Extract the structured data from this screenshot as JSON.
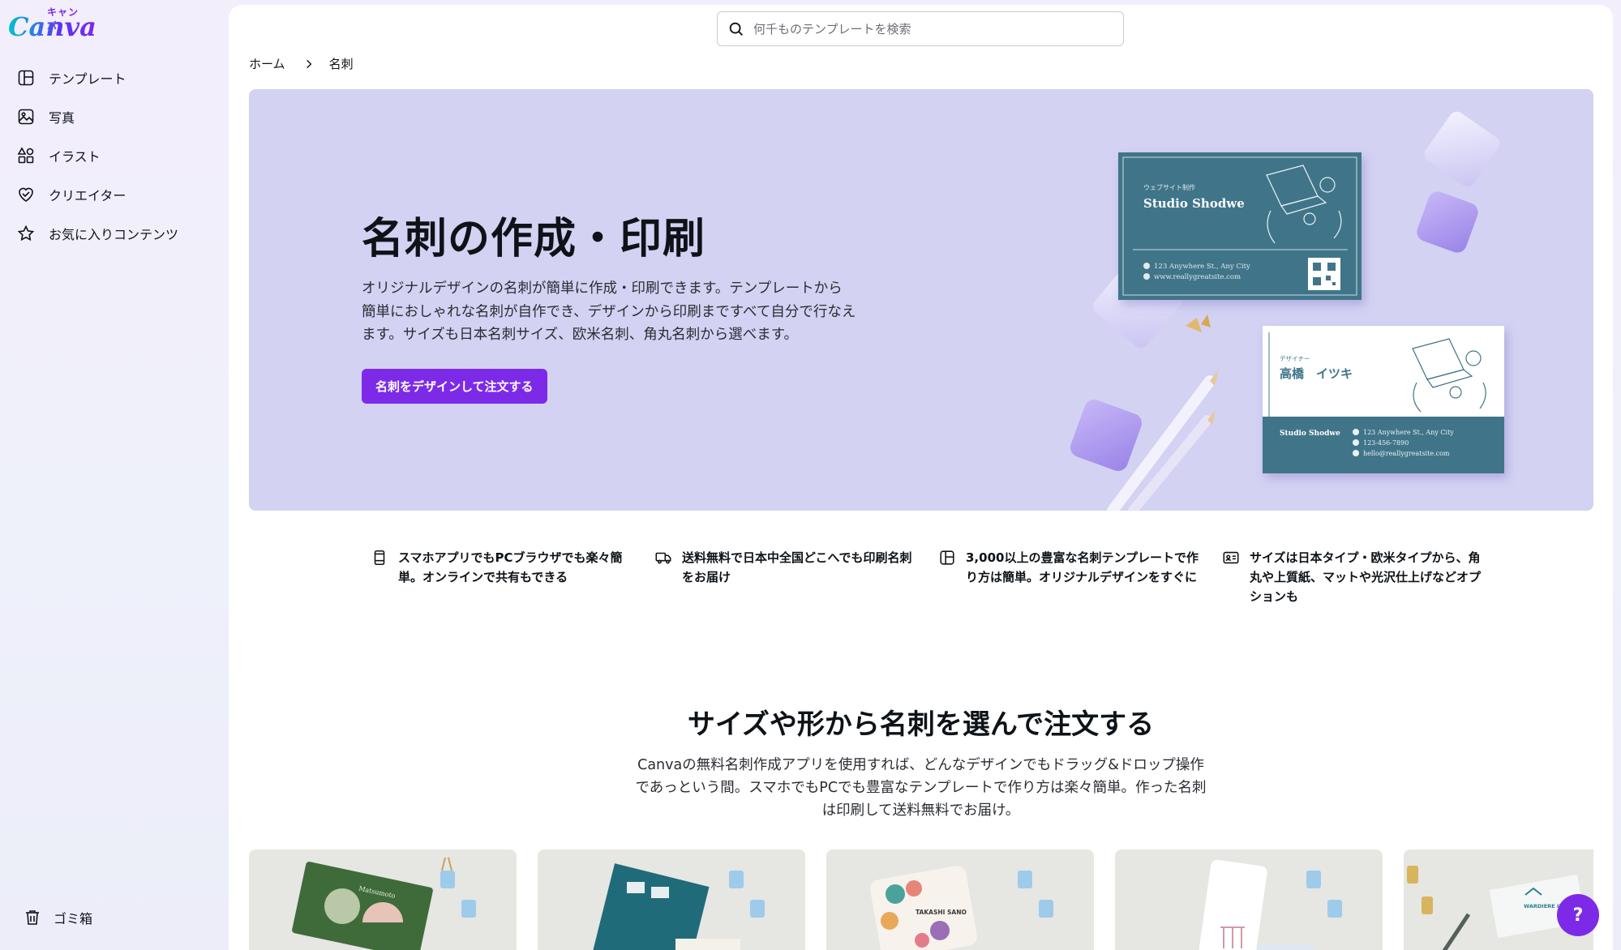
{
  "brand": {
    "logo_kana": "キャンバ",
    "logo_word": "Canva"
  },
  "sidebar": {
    "items": [
      {
        "label": "テンプレート",
        "icon": "template-icon"
      },
      {
        "label": "写真",
        "icon": "photo-icon"
      },
      {
        "label": "イラスト",
        "icon": "shapes-icon"
      },
      {
        "label": "クリエイター",
        "icon": "heart-icon"
      },
      {
        "label": "お気に入りコンテンツ",
        "icon": "star-icon"
      }
    ],
    "trash_label": "ゴミ箱"
  },
  "search": {
    "placeholder": "何千ものテンプレートを検索"
  },
  "breadcrumb": {
    "home": "ホーム",
    "current": "名刺"
  },
  "hero": {
    "title": "名刺の作成・印刷",
    "description": "オリジナルデザインの名刺が簡単に作成・印刷できます。テンプレートから簡単におしゃれな名刺が自作でき、デザインから印刷まですべて自分で行なえます。サイズも日本名刺サイズ、欧米名刺、角丸名刺から選べます。",
    "cta_label": "名刺をデザインして注文する",
    "card1": {
      "subtitle": "ウェブサイト制作",
      "name": "Studio Shodwe",
      "address": "123 Anywhere St., Any City",
      "site": "www.reallygreatsite.com"
    },
    "card2": {
      "role": "デザイナー",
      "name": "高橋　イツキ",
      "company": "Studio Shodwe",
      "address": "123 Anywhere St., Any City",
      "phone": "123-456-7890",
      "email": "hello@reallygreatsite.com"
    }
  },
  "features": [
    {
      "icon": "smartphone-icon",
      "text": "スマホアプリでもPCブラウザでも楽々簡単。オンラインで共有もできる"
    },
    {
      "icon": "truck-icon",
      "text": "送料無料で日本中全国どこへでも印刷名刺をお届け"
    },
    {
      "icon": "template-icon",
      "text": "3,000以上の豊富な名刺テンプレートで作り方は簡単。オリジナルデザインをすぐに"
    },
    {
      "icon": "id-card-icon",
      "text": "サイズは日本タイプ・欧米タイプから、角丸や上質紙、マットや光沢仕上げなどオプションも"
    }
  ],
  "section": {
    "title": "サイズや形から名刺を選んで注文する",
    "description": "Canvaの無料名刺作成アプリを使用すれば、どんなデザインでもドラッグ&ドロップ操作であっという間。スマホでもPCでも豊富なテンプレートで作り方は楽々簡単。作った名刺は印刷して送料無料でお届け。"
  },
  "cards": [
    {
      "caption": "Matsumoto"
    },
    {
      "caption": ""
    },
    {
      "caption": "TAKASHI SANO"
    },
    {
      "caption": ""
    },
    {
      "caption": "WARDIERE INC."
    }
  ],
  "help": {
    "label": "?"
  },
  "colors": {
    "accent": "#7d2ae8",
    "hero_bg": "#d3d2f3",
    "card_teal": "#3f7489"
  }
}
